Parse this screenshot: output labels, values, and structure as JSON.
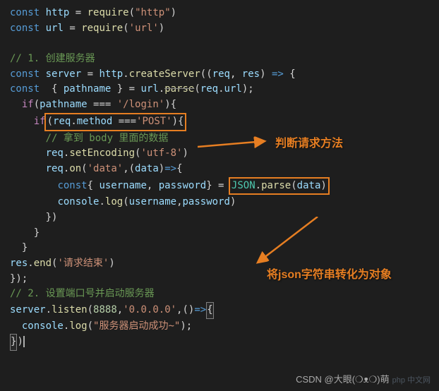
{
  "code": {
    "l1_const": "const",
    "l1_http": "http",
    "l1_eq": " = ",
    "l1_require": "require",
    "l1_arg": "\"http\"",
    "l2_url": "url",
    "l2_arg": "'url'",
    "c1": "// 1. 创建服务器",
    "l4_server": "server",
    "l4_httpvar": "http",
    "l4_create": "createServer",
    "l4_req": "req",
    "l4_res": "res",
    "l5_pathname": "pathname",
    "l5_urlvar": "url",
    "l5_parse": "parse",
    "l5_requrl": "req.url",
    "l6_if": "if",
    "l6_pathvar": "pathname",
    "l6_login": "'/login'",
    "l7_method": "req.method",
    "l7_post": "'POST'",
    "c2": "// 拿到 body 里面的数据",
    "l9_setenc": "setEncoding",
    "l9_utf": "'utf-8'",
    "l10_on": "on",
    "l10_data": "'data'",
    "l10_param": "data",
    "l11_user": "username",
    "l11_pass": "password",
    "l11_json": "JSON",
    "l11_parse": "parse",
    "l11_arg": "data",
    "l12_log": "log",
    "l12_console": "console",
    "l17_resend": "res",
    "l17_end": "end",
    "l17_str": "'请求结束'",
    "c3": "// 2. 设置端口号并启动服务器",
    "l19_listen": "listen",
    "l19_port": "8888",
    "l19_host": "'0.0.0.0'",
    "l20_msg": "\"服务器启动成功~\""
  },
  "anno1": "判断请求方法",
  "anno2": "将json字符串转化为对象",
  "watermark": "CSDN @大眼(❍ᴥ❍)萌",
  "watermark2": "php 中文网"
}
